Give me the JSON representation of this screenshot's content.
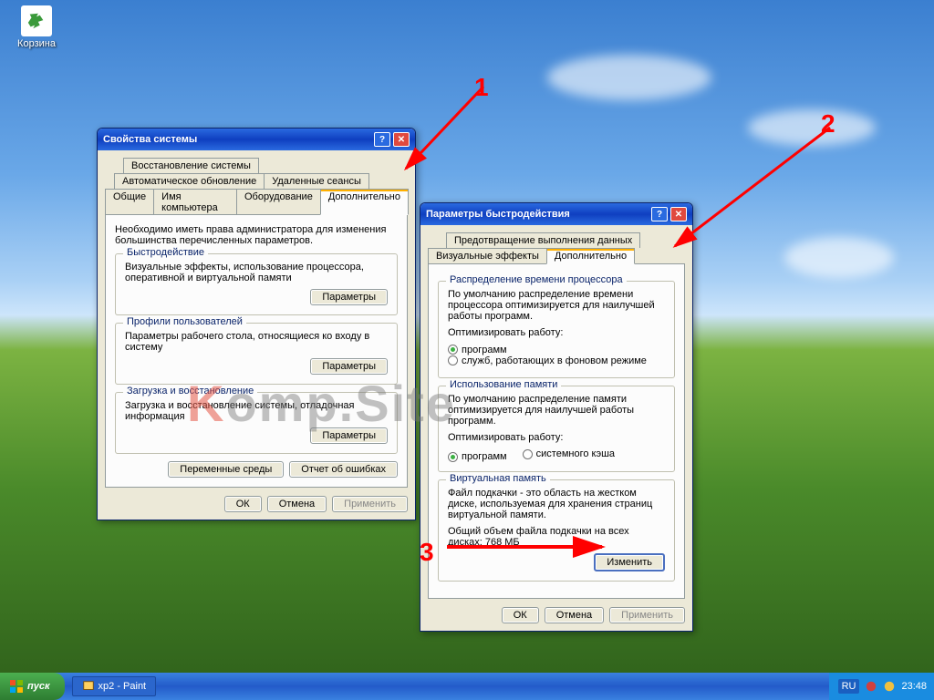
{
  "desktop": {
    "recycle_label": "Корзина"
  },
  "window1": {
    "title": "Свойства системы",
    "tabs_row1": [
      "Восстановление системы"
    ],
    "tabs_row2": [
      "Автоматическое обновление",
      "Удаленные сеансы"
    ],
    "tabs_row3": [
      "Общие",
      "Имя компьютера",
      "Оборудование",
      "Дополнительно"
    ],
    "admin_note": "Необходимо иметь права администратора для изменения большинства перечисленных параметров.",
    "group_perf": {
      "title": "Быстродействие",
      "text": "Визуальные эффекты, использование процессора, оперативной и виртуальной памяти",
      "button": "Параметры"
    },
    "group_profiles": {
      "title": "Профили пользователей",
      "text": "Параметры рабочего стола, относящиеся ко входу в систему",
      "button": "Параметры"
    },
    "group_startup": {
      "title": "Загрузка и восстановление",
      "text": "Загрузка и восстановление системы, отладочная информация",
      "button": "Параметры"
    },
    "env_button": "Переменные среды",
    "err_button": "Отчет об ошибках",
    "ok": "ОК",
    "cancel": "Отмена",
    "apply": "Применить"
  },
  "window2": {
    "title": "Параметры быстродействия",
    "tabs_row1": [
      "Предотвращение выполнения данных"
    ],
    "tabs_row2": [
      "Визуальные эффекты",
      "Дополнительно"
    ],
    "group_cpu": {
      "title": "Распределение времени процессора",
      "text": "По умолчанию распределение времени процессора оптимизируется для наилучшей работы программ.",
      "optimize_label": "Оптимизировать работу:",
      "opt1": "программ",
      "opt2": "служб, работающих в фоновом режиме"
    },
    "group_mem": {
      "title": "Использование памяти",
      "text": "По умолчанию распределение памяти оптимизируется для наилучшей работы программ.",
      "optimize_label": "Оптимизировать работу:",
      "opt1": "программ",
      "opt2": "системного кэша"
    },
    "group_vm": {
      "title": "Виртуальная память",
      "text": "Файл подкачки - это область на жестком диске, используемая для хранения страниц виртуальной памяти.",
      "total_label": "Общий объем файла подкачки на всех дисках:  768 МБ",
      "button": "Изменить"
    },
    "ok": "ОК",
    "cancel": "Отмена",
    "apply": "Применить"
  },
  "taskbar": {
    "start": "пуск",
    "task1": "xp2 - Paint",
    "lang": "RU",
    "time": "23:48"
  },
  "annotations": {
    "a1": "1",
    "a2": "2",
    "a3": "3"
  },
  "watermark": {
    "k": "K",
    "rest": "omp.Site"
  }
}
